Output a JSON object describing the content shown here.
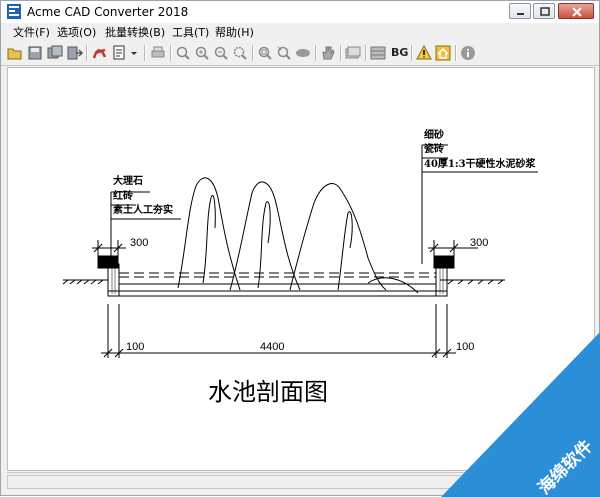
{
  "window": {
    "title": "Acme CAD Converter 2018"
  },
  "menu": [
    {
      "label": "文件(F)"
    },
    {
      "label": "选项(O)"
    },
    {
      "label": "批量转换(B)"
    },
    {
      "label": "工具(T)"
    },
    {
      "label": "帮助(H)"
    }
  ],
  "toolbar": {
    "bg_label": "BG"
  },
  "drawing": {
    "title": "水池剖面图",
    "left_labels": [
      "大理石",
      "红砖",
      "素土人工夯实"
    ],
    "right_labels": [
      "细砂",
      "瓷砖",
      "40厚1:3干硬性水泥砂浆"
    ],
    "dim_top_left": "300",
    "dim_top_right": "300",
    "dim_bottom_left": "100",
    "dim_bottom_mid": "4400",
    "dim_bottom_right": "100"
  },
  "watermark": {
    "text": "海绵软件"
  },
  "colors": {
    "watermark_blue": "#2a8fd6",
    "title_bar": "#ffffff",
    "close_button": "#c8523f"
  }
}
